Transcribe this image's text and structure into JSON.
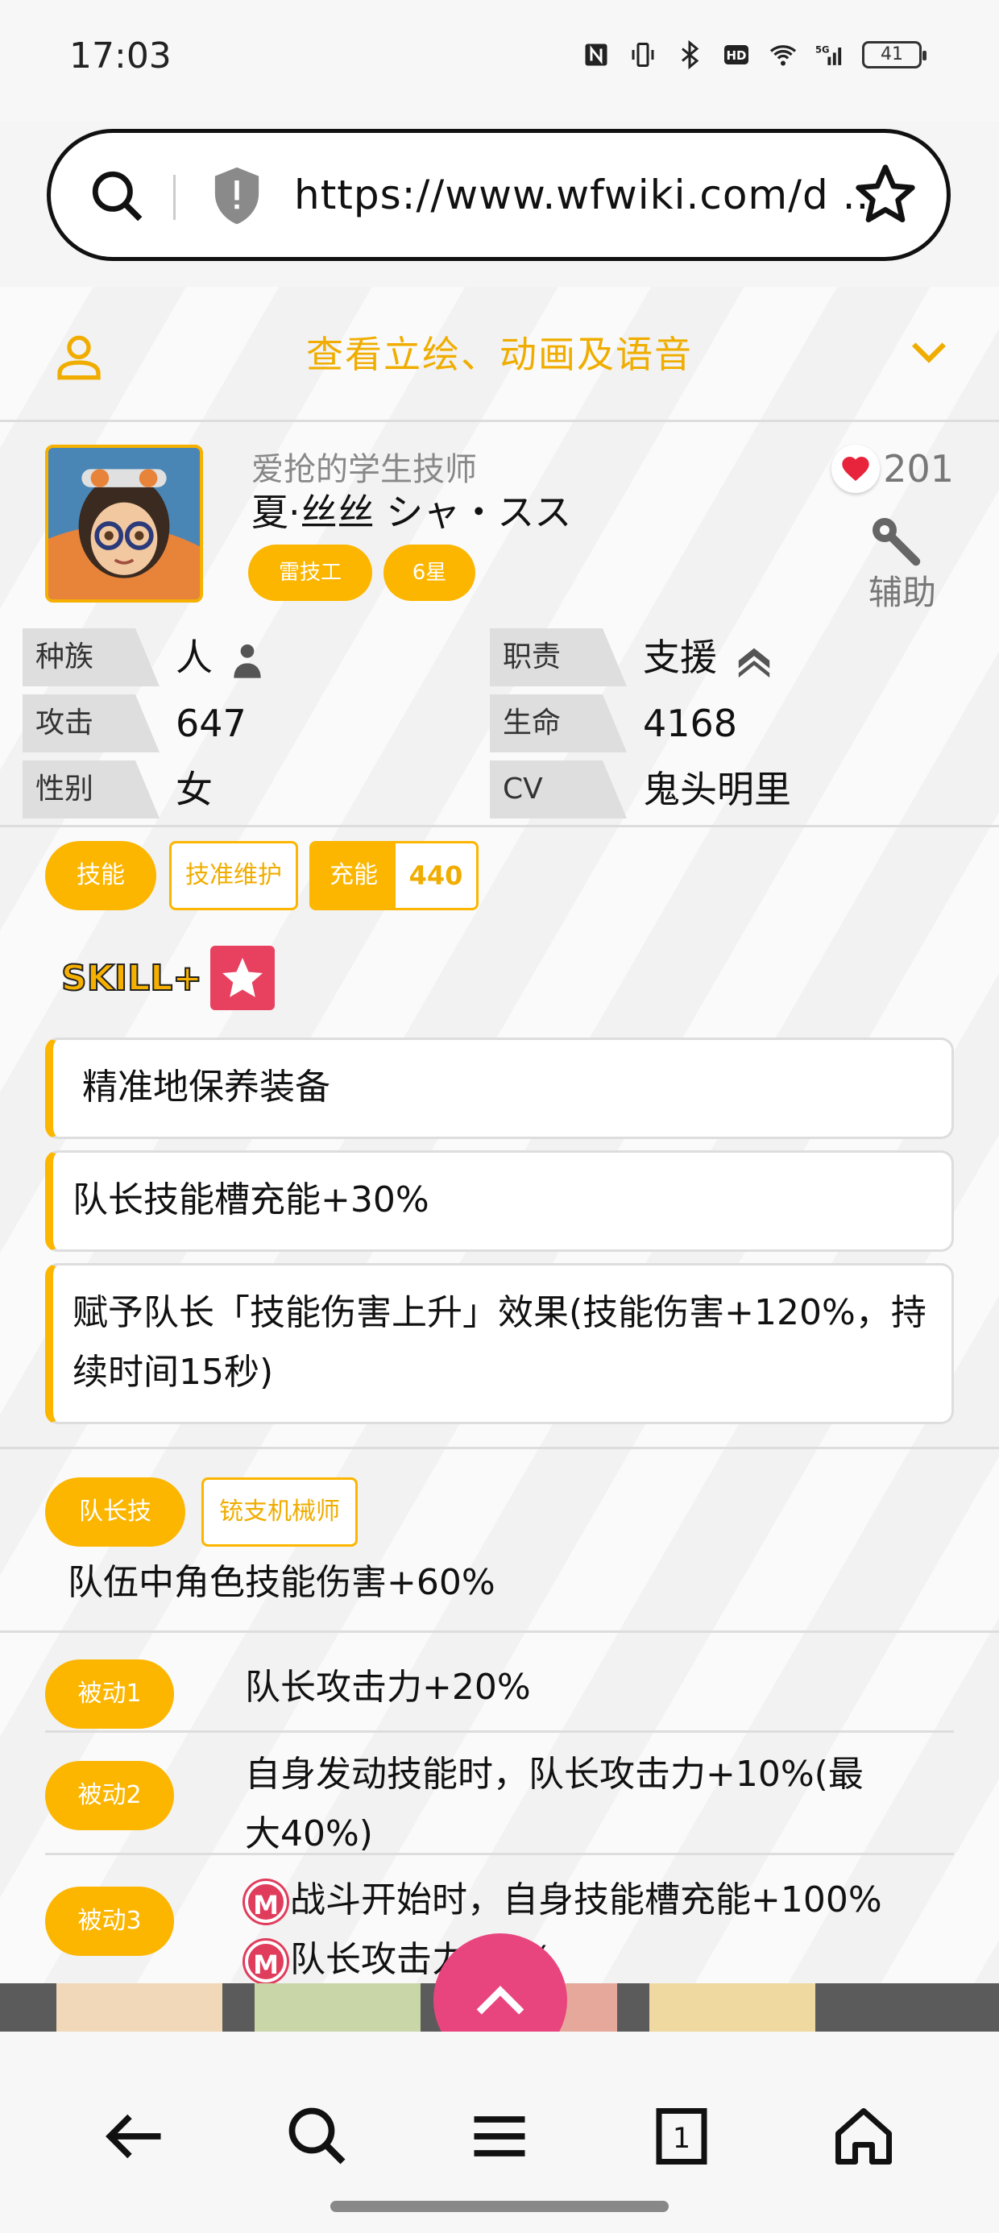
{
  "status_bar": {
    "time": "17:03",
    "battery": "41",
    "icons": [
      "nfc-icon",
      "vibrate-icon",
      "bluetooth-icon",
      "hd-icon",
      "wifi-icon",
      "signal-5g-icon"
    ]
  },
  "url_bar": {
    "url": "https://www.wfwiki.com/d ..."
  },
  "character": {
    "header_title": "查看立绘、动画及语音",
    "subtitle": "爱抢的学生技师",
    "name": "夏·丝丝 シャ・スス",
    "badges": [
      "雷技工",
      "6星"
    ],
    "likes": "201",
    "role": "辅助",
    "stats": [
      {
        "key": "种族",
        "value": "人"
      },
      {
        "key": "职责",
        "value": "支援"
      },
      {
        "key": "攻击",
        "value": "647"
      },
      {
        "key": "生命",
        "value": "4168"
      },
      {
        "key": "性别",
        "value": "女"
      },
      {
        "key": "CV",
        "value": "鬼头明里"
      }
    ]
  },
  "skill": {
    "tag": "技能",
    "name_tag": "技准维护",
    "charge_label": "充能",
    "charge_value": "440",
    "skillplus_label": "SKILL+",
    "title": "精准地保养装备",
    "effects": [
      "队长技能槽充能+30%",
      "赋予队长「技能伤害上升」效果(技能伤害+120%，持续时间15秒)"
    ]
  },
  "leader": {
    "tag": "队长技",
    "name_tag": "铳支机械师",
    "effect": "队伍中角色技能伤害+60%"
  },
  "passives": [
    {
      "tag": "被动1",
      "lines": [
        "队长攻击力+20%"
      ]
    },
    {
      "tag": "被动2",
      "lines": [
        "自身发动技能时，队长攻击力+10%(最",
        "大40%)"
      ]
    },
    {
      "tag": "被动3",
      "lines": [
        "战斗开始时，自身技能槽充能+100%",
        "队长攻击力+0%"
      ]
    }
  ],
  "colors": {
    "accent": "#fcb600",
    "fab": "#e8457f",
    "heart": "#e8243c"
  }
}
